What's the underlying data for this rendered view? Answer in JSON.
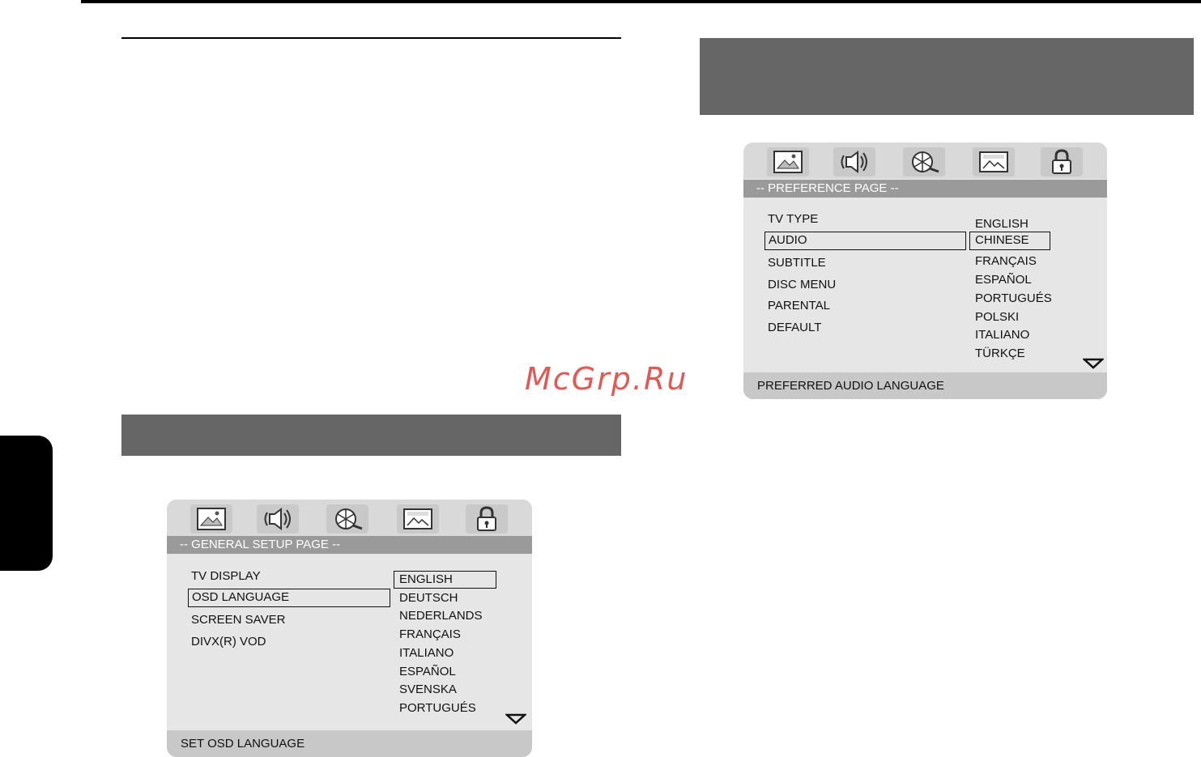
{
  "watermark": "McGrp.Ru",
  "preference_menu": {
    "page_title": "-- PREFERENCE PAGE --",
    "items": [
      "TV TYPE",
      "AUDIO",
      "SUBTITLE",
      "DISC MENU",
      "PARENTAL",
      "DEFAULT"
    ],
    "selected_item": "AUDIO",
    "options": [
      "ENGLISH",
      "CHINESE",
      "FRANÇAIS",
      "ESPAÑOL",
      "PORTUGUÉS",
      "POLSKI",
      "ITALIANO",
      "TÜRKÇE"
    ],
    "selected_option": "CHINESE",
    "status": "PREFERRED AUDIO LANGUAGE"
  },
  "general_menu": {
    "page_title": "-- GENERAL SETUP PAGE --",
    "items": [
      "TV DISPLAY",
      "OSD LANGUAGE",
      "SCREEN SAVER",
      "DIVX(R) VOD"
    ],
    "selected_item": "OSD LANGUAGE",
    "options": [
      "ENGLISH",
      "DEUTSCH",
      "NEDERLANDS",
      "FRANÇAIS",
      "ITALIANO",
      "ESPAÑOL",
      "SVENSKA",
      "PORTUGUÉS"
    ],
    "selected_option": "ENGLISH",
    "status": "SET OSD LANGUAGE"
  },
  "icons": [
    "general-setup-icon",
    "audio-setup-icon",
    "video-setup-icon",
    "preference-icon",
    "password-lock-icon"
  ]
}
